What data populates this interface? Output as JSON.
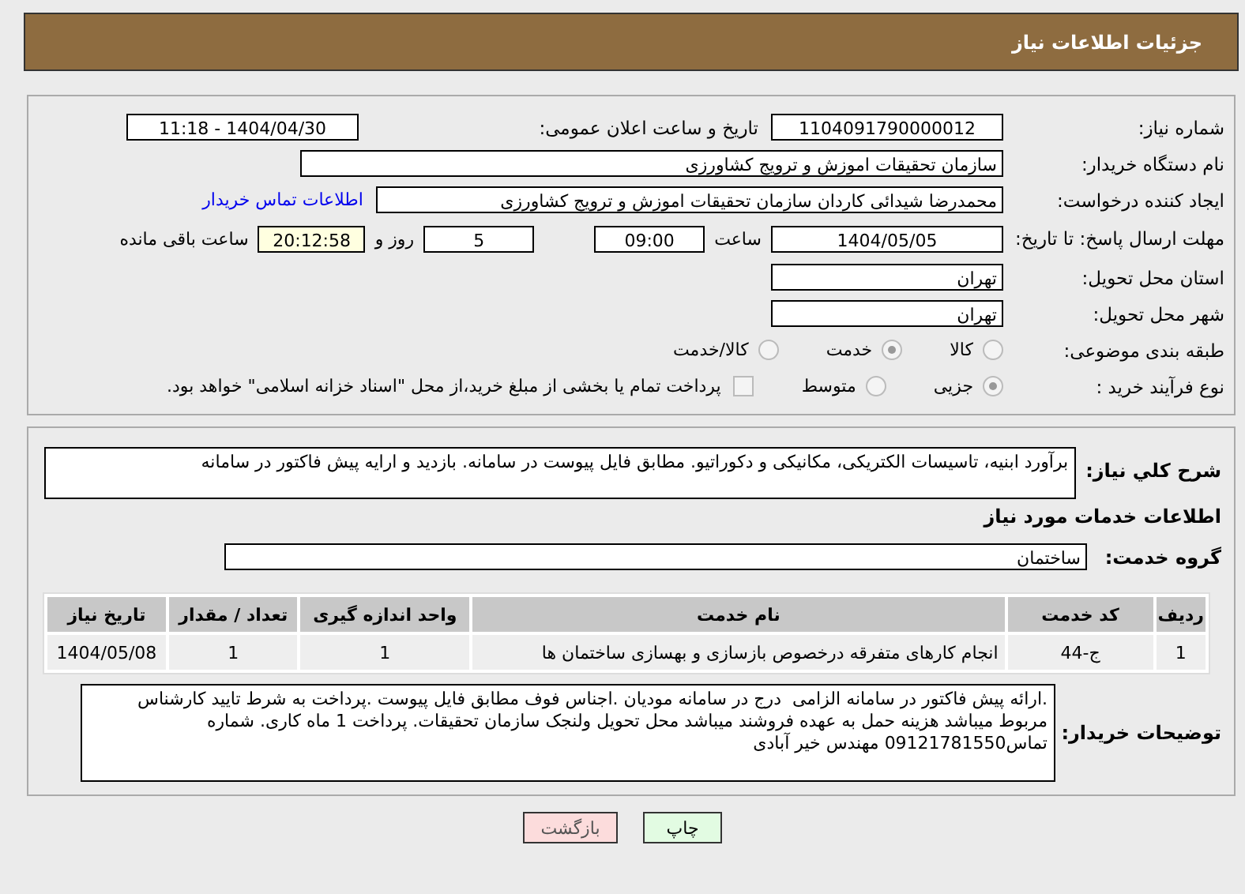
{
  "header": {
    "title": "جزئیات اطلاعات نیاز"
  },
  "need_number": {
    "label": "شماره نیاز:",
    "value": "1104091790000012"
  },
  "announce": {
    "label": "تاریخ و ساعت اعلان عمومی:",
    "value": "1404/04/30 - 11:18"
  },
  "buyer_org": {
    "label": "نام دستگاه خریدار:",
    "value": "سازمان تحقیقات  اموزش و ترویج کشاورزی"
  },
  "requester": {
    "label": "ایجاد کننده درخواست:",
    "value": "محمدرضا شیدائی کاردان سازمان تحقیقات  اموزش و ترویج کشاورزی",
    "link": "اطلاعات تماس خریدار"
  },
  "deadline": {
    "label": "مهلت ارسال پاسخ: تا تاریخ:",
    "date": "1404/05/05",
    "time_label": "ساعت",
    "time": "09:00",
    "days": "5",
    "days_label": "روز و",
    "remaining": "20:12:58",
    "remaining_label": "ساعت باقی مانده"
  },
  "province": {
    "label": "استان محل تحویل:",
    "value": "تهران"
  },
  "city": {
    "label": "شهر محل تحویل:",
    "value": "تهران"
  },
  "category": {
    "label": "طبقه بندی موضوعی:",
    "options": [
      {
        "label": "کالا",
        "selected": false
      },
      {
        "label": "خدمت",
        "selected": true
      },
      {
        "label": "کالا/خدمت",
        "selected": false
      }
    ]
  },
  "process": {
    "label": "نوع فرآیند خرید :",
    "options": [
      {
        "label": "جزیی",
        "selected": true
      },
      {
        "label": "متوسط",
        "selected": false
      }
    ],
    "payment": {
      "checked": false,
      "text": "پرداخت تمام یا بخشی از مبلغ خرید،از محل \"اسناد خزانه اسلامی\" خواهد بود."
    }
  },
  "description": {
    "label": "شرح کلي نیاز:",
    "value": "برآورد ابنیه، تاسیسات الکتریکی، مکانیکی و دکوراتیو. مطابق فایل پیوست در سامانه. بازدید و ارایه پیش فاکتور در سامانه"
  },
  "services_title": "اطلاعات خدمات مورد نیاز",
  "service_group": {
    "label": "گروه خدمت:",
    "value": "ساختمان"
  },
  "table": {
    "columns": [
      "ردیف",
      "کد خدمت",
      "نام خدمت",
      "واحد اندازه گیری",
      "تعداد / مقدار",
      "تاریخ نیاز"
    ],
    "rows": [
      [
        "1",
        "ج-44",
        "انجام کارهای متفرقه درخصوص بازسازی و بهسازی ساختمان ها",
        "1",
        "1",
        "1404/05/08"
      ]
    ]
  },
  "buyer_notes": {
    "label": "توضیحات خریدار:",
    "value": ".ارائه پیش فاکتور در سامانه الزامی  درج در سامانه مودیان .اجناس فوف مطابق فایل پیوست .پرداخت به شرط تایید کارشناس مربوط میباشد هزینه حمل به عهده فروشند میباشد محل تحویل ولنجک سازمان تحقیقات. پرداخت 1 ماه کاری. شماره تماس09121781550 مهندس خیر آبادی"
  },
  "buttons": [
    {
      "label": "چاپ",
      "kind": "print"
    },
    {
      "label": "بازگشت",
      "kind": "back"
    }
  ]
}
